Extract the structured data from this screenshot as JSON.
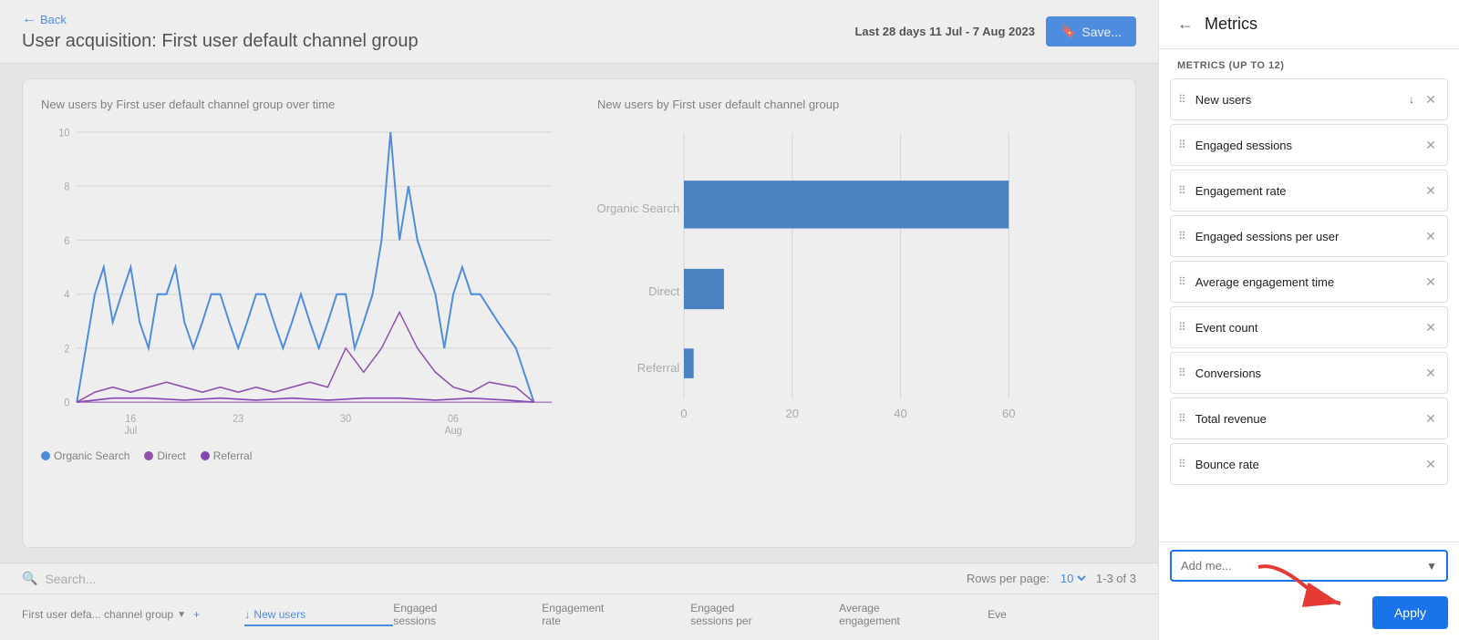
{
  "header": {
    "back_label": "Back",
    "title": "User acquisition: First user default channel group",
    "date_label": "Last 28 days",
    "date_range": "11 Jul - 7 Aug 2023",
    "save_label": "Save..."
  },
  "line_chart": {
    "title": "New users by First user default channel group over time",
    "x_labels": [
      "16\nJul",
      "23",
      "30",
      "06\nAug"
    ],
    "y_labels": [
      "0",
      "2",
      "4",
      "6",
      "8",
      "10"
    ]
  },
  "bar_chart": {
    "title": "New users by First user default channel group",
    "categories": [
      "Organic Search",
      "Direct",
      "Referral"
    ],
    "values": [
      65,
      8,
      2
    ],
    "x_labels": [
      "0",
      "20",
      "40",
      "60"
    ]
  },
  "legend": {
    "items": [
      {
        "label": "Organic Search",
        "color": "#1a73e8"
      },
      {
        "label": "Direct",
        "color": "#7b1fa2"
      },
      {
        "label": "Referral",
        "color": "#6a0dad"
      }
    ]
  },
  "bottom": {
    "search_placeholder": "Search...",
    "rows_per_page_label": "Rows per page:",
    "rows_per_page_value": "10",
    "pagination": "1-3 of 3"
  },
  "col_headers": [
    {
      "label": "First user defa... channel group",
      "active": false,
      "has_sort": true
    },
    {
      "label": "New users",
      "active": true,
      "has_sort": true
    },
    {
      "label": "Engaged\nsessions",
      "active": false,
      "has_sort": false
    },
    {
      "label": "Engagement\nrate",
      "active": false,
      "has_sort": false
    },
    {
      "label": "Engaged\nsessions per",
      "active": false,
      "has_sort": false
    },
    {
      "label": "Average\nengagement",
      "active": false,
      "has_sort": false
    },
    {
      "label": "Eve",
      "active": false,
      "has_sort": false
    }
  ],
  "panel": {
    "title": "Metrics",
    "section_label": "METRICS (UP TO 12)",
    "metrics": [
      {
        "name": "New users",
        "has_sort": true
      },
      {
        "name": "Engaged sessions",
        "has_sort": false
      },
      {
        "name": "Engagement rate",
        "has_sort": false
      },
      {
        "name": "Engaged sessions per user",
        "has_sort": false
      },
      {
        "name": "Average engagement time",
        "has_sort": false
      },
      {
        "name": "Event count",
        "has_sort": false
      },
      {
        "name": "Conversions",
        "has_sort": false
      },
      {
        "name": "Total revenue",
        "has_sort": false
      },
      {
        "name": "Bounce rate",
        "has_sort": false
      }
    ],
    "add_metric_placeholder": "Add me...",
    "apply_label": "Apply"
  }
}
